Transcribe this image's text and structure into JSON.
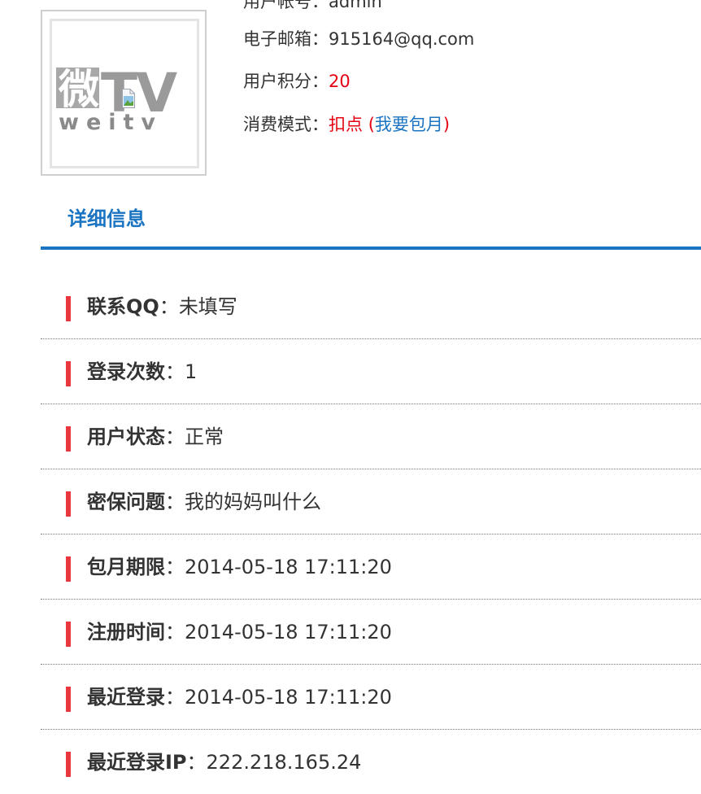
{
  "profile": {
    "logo": {
      "text_main": "微TV",
      "text_sub": "weitv",
      "icon": "broken-image-icon"
    },
    "lines": [
      {
        "label": "用户帐号",
        "sep": "：",
        "value": "admin"
      },
      {
        "label": "电子邮箱",
        "sep": "：",
        "value": "915164@qq.com"
      },
      {
        "label": "用户积分",
        "sep": "：",
        "value": "20"
      },
      {
        "label": "消费模式",
        "sep": "：",
        "value": "扣点",
        "paren_open": "(",
        "link": "我要包月",
        "paren_close": ")"
      }
    ]
  },
  "tab": {
    "label": "详细信息"
  },
  "details": [
    {
      "label": "联系QQ",
      "sep": "：",
      "value": "未填写"
    },
    {
      "label": "登录次数",
      "sep": "：",
      "value": "1"
    },
    {
      "label": "用户状态",
      "sep": "：",
      "value": "正常"
    },
    {
      "label": "密保问题",
      "sep": "：",
      "value": "我的妈妈叫什么"
    },
    {
      "label": "包月期限",
      "sep": "：",
      "value": "2014-05-18 17:11:20"
    },
    {
      "label": "注册时间",
      "sep": "：",
      "value": "2014-05-18 17:11:20"
    },
    {
      "label": "最近登录",
      "sep": "：",
      "value": "2014-05-18 17:11:20"
    },
    {
      "label": "最近登录IP",
      "sep": "：",
      "value": "222.218.165.24"
    }
  ],
  "colors": {
    "accent_blue": "#1a74c2",
    "highlight_red": "#e60012",
    "marker_red": "#e8383d"
  }
}
